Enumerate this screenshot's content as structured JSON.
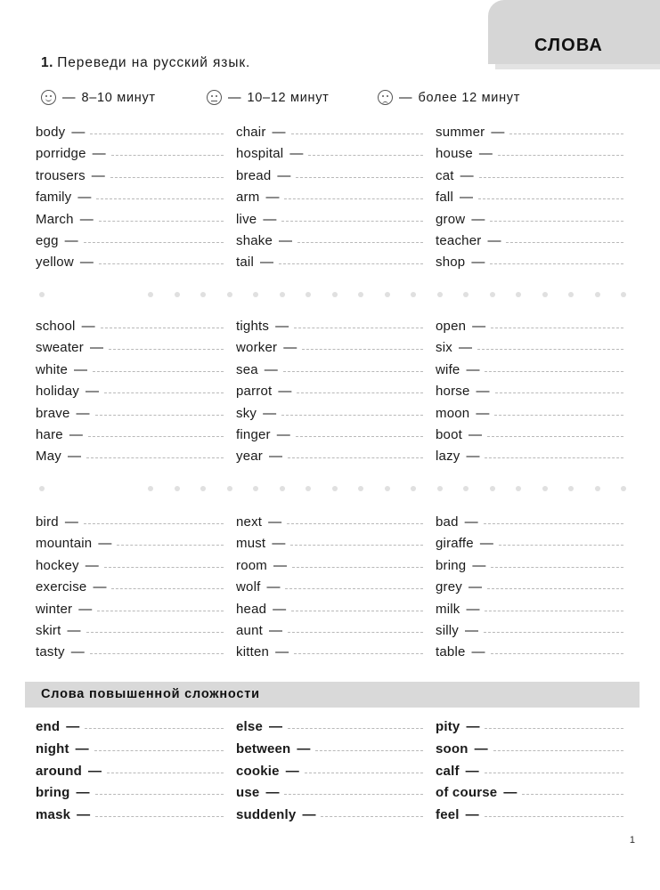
{
  "header": {
    "tab_label": "СЛОВА",
    "tab_bg": "#d6d6d6"
  },
  "task": {
    "number": "1.",
    "instruction": "Переведи  на  русский  язык."
  },
  "legend": {
    "items": [
      {
        "icon": "happy-face-icon",
        "dash": "—",
        "text": "8–10  минут"
      },
      {
        "icon": "neutral-face-icon",
        "dash": "—",
        "text": "10–12  минут"
      },
      {
        "icon": "sad-face-icon",
        "dash": "—",
        "text": "более  12  минут"
      }
    ]
  },
  "dash": "—",
  "blocks": [
    {
      "columns": [
        {
          "words": [
            "body",
            "porridge",
            "trousers",
            "family",
            "March",
            "egg",
            "yellow"
          ]
        },
        {
          "words": [
            "chair",
            "hospital",
            "bread",
            "arm",
            "live",
            "shake",
            "tail"
          ]
        },
        {
          "words": [
            "summer",
            "house",
            "cat",
            "fall",
            "grow",
            "teacher",
            "shop"
          ]
        }
      ]
    },
    {
      "columns": [
        {
          "words": [
            "school",
            "sweater",
            "white",
            "holiday",
            "brave",
            "hare",
            "May"
          ]
        },
        {
          "words": [
            "tights",
            "worker",
            "sea",
            "parrot",
            "sky",
            "finger",
            "year"
          ]
        },
        {
          "words": [
            "open",
            "six",
            "wife",
            "horse",
            "moon",
            "boot",
            "lazy"
          ]
        }
      ]
    },
    {
      "columns": [
        {
          "words": [
            "bird",
            "mountain",
            "hockey",
            "exercise",
            "winter",
            "skirt",
            "tasty"
          ]
        },
        {
          "words": [
            "next",
            "must",
            "room",
            "wolf",
            "head",
            "aunt",
            "kitten"
          ]
        },
        {
          "words": [
            "bad",
            "giraffe",
            "bring",
            "grey",
            "milk",
            "silly",
            "table"
          ]
        }
      ]
    }
  ],
  "subsection": {
    "title": "Слова  повышенной  сложности",
    "bg": "#d9d9d9",
    "columns": [
      {
        "words": [
          "end",
          "night",
          "around",
          "bring",
          "mask"
        ]
      },
      {
        "words": [
          "else",
          "between",
          "cookie",
          "use",
          "suddenly"
        ]
      },
      {
        "words": [
          "pity",
          "soon",
          "calf",
          "of  course",
          "feel"
        ]
      }
    ]
  },
  "footer": {
    "page_number": "1"
  }
}
